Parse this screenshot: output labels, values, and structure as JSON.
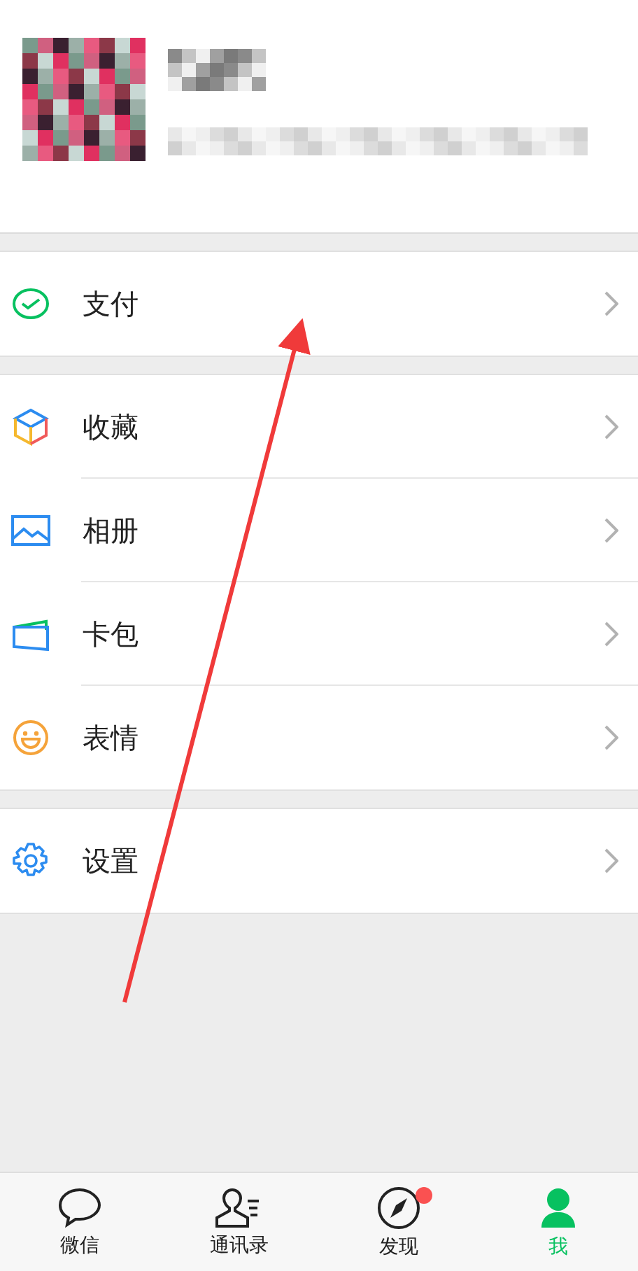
{
  "sections": [
    {
      "items": [
        {
          "label": "支付"
        }
      ]
    },
    {
      "items": [
        {
          "label": "收藏"
        },
        {
          "label": "相册"
        },
        {
          "label": "卡包"
        },
        {
          "label": "表情"
        }
      ]
    },
    {
      "items": [
        {
          "label": "设置"
        }
      ]
    }
  ],
  "tabs": [
    {
      "label": "微信",
      "selected": false,
      "badge": false
    },
    {
      "label": "通讯录",
      "selected": false,
      "badge": false
    },
    {
      "label": "发现",
      "selected": false,
      "badge": true
    },
    {
      "label": "我",
      "selected": true,
      "badge": false
    }
  ]
}
